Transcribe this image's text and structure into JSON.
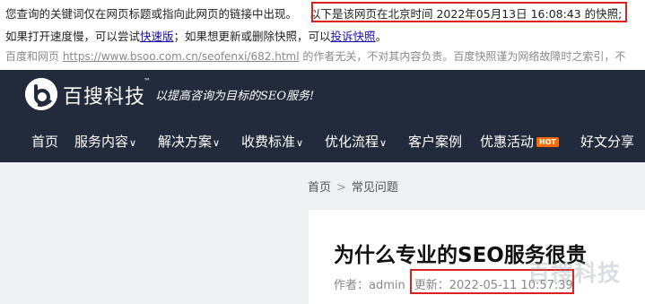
{
  "snapshot": {
    "line1_notice": "您查询的关键词仅在网页标题或指向此网页的链接中出现。",
    "line1_time": "以下是该网页在北京时间 2022年05月13日 16:08:43 的快照;",
    "line2_pre": "如果打开速度慢，可以尝试",
    "line2_fast_link": "快速版",
    "line2_mid": "；如果想更新或删除快照，可以",
    "line2_complain_link": "投诉快照",
    "line2_end": "。",
    "line3_pre": "百度和网页 ",
    "line3_url": "https://www.bsoo.com.cn/seofenxi/682.html",
    "line3_post": " 的作者无关，不对其内容负责。百度快照谨为网络故障时之索引，不"
  },
  "header": {
    "brand_name": "百搜科技",
    "trademark": "™",
    "slogan": "以提高咨询为目标的SEO服务!"
  },
  "nav": {
    "items": [
      {
        "label": "首页"
      },
      {
        "label": "服务内容"
      },
      {
        "label": "解决方案"
      },
      {
        "label": "收费标准"
      },
      {
        "label": "优化流程"
      },
      {
        "label": "客户案例"
      },
      {
        "label": "优惠活动"
      },
      {
        "label": "好文分享"
      }
    ],
    "hot_badge": "HOT"
  },
  "breadcrumb": {
    "home": "首页",
    "separator": ">",
    "current": "常见问题"
  },
  "article": {
    "title": "为什么专业的SEO服务很贵",
    "author": "作者：admin",
    "updated": "更新：2022-05-11 10:57:39"
  },
  "watermark": "百搜科技",
  "colors": {
    "header_bg": "#222b3b",
    "highlight_border": "#d9231f",
    "hot_badge": "#ff6a00",
    "link": "#1a0dab"
  }
}
